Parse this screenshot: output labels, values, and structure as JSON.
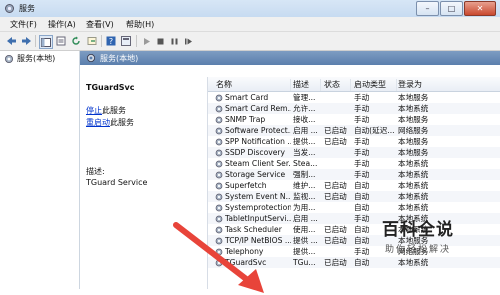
{
  "window": {
    "title": "服务",
    "buttons": {
      "min": "–",
      "max": "□",
      "close": "✕"
    }
  },
  "menu": [
    "文件(F)",
    "操作(A)",
    "查看(V)",
    "帮助(H)"
  ],
  "toolbar": {
    "icons": [
      "back-icon",
      "forward-icon",
      "console-tree-icon",
      "properties-icon",
      "refresh-icon",
      "export-icon",
      "help-icon",
      "view-icon",
      "play-icon",
      "stop-icon",
      "pause-icon",
      "restart-icon"
    ]
  },
  "tree": {
    "root_label": "服务(本地)"
  },
  "main": {
    "header_title": "服务(本地)",
    "selected_service": "TGuardSvc",
    "stop_link": "停止",
    "stop_suffix": "此服务",
    "restart_link": "重启动",
    "restart_suffix": "此服务",
    "desc_label": "描述:",
    "desc_text": "TGuard Service"
  },
  "list": {
    "columns": [
      "名称",
      "描述",
      "状态",
      "启动类型",
      "登录为"
    ],
    "rows": [
      [
        "Smart Card",
        "管理...",
        "",
        "手动",
        "本地服务"
      ],
      [
        "Smart Card Rem...",
        "允许...",
        "",
        "手动",
        "本地系统"
      ],
      [
        "SNMP Trap",
        "接收...",
        "",
        "手动",
        "本地服务"
      ],
      [
        "Software Protect...",
        "启用 ...",
        "已启动",
        "自动(延迟...",
        "网络服务"
      ],
      [
        "SPP Notification ...",
        "提供...",
        "已启动",
        "手动",
        "本地服务"
      ],
      [
        "SSDP Discovery",
        "当发...",
        "",
        "手动",
        "本地服务"
      ],
      [
        "Steam Client Ser...",
        "Stea...",
        "",
        "手动",
        "本地系统"
      ],
      [
        "Storage Service",
        "强制...",
        "",
        "手动",
        "本地系统"
      ],
      [
        "Superfetch",
        "维护...",
        "已启动",
        "自动",
        "本地系统"
      ],
      [
        "System Event N...",
        "监视...",
        "已启动",
        "自动",
        "本地系统"
      ],
      [
        "Systemprotection",
        "为用...",
        "",
        "自动",
        "本地系统"
      ],
      [
        "TabletInputServi...",
        "启用 ...",
        "",
        "手动",
        "本地系统"
      ],
      [
        "Task Scheduler",
        "使用...",
        "已启动",
        "自动",
        "本地系统"
      ],
      [
        "TCP/IP NetBIOS ...",
        "提供 ...",
        "已启动",
        "自动",
        "本地服务"
      ],
      [
        "Telephony",
        "提供...",
        "",
        "手动",
        "网络服务"
      ],
      [
        "TGuardSvc",
        "TGu...",
        "已启动",
        "自动",
        "本地系统"
      ]
    ]
  },
  "watermark": {
    "logo": "百科全说",
    "sub": "助你轻松解决"
  },
  "colors": {
    "header": "#5b7fad",
    "link": "#0033cc",
    "arrow": "#e8443a"
  }
}
